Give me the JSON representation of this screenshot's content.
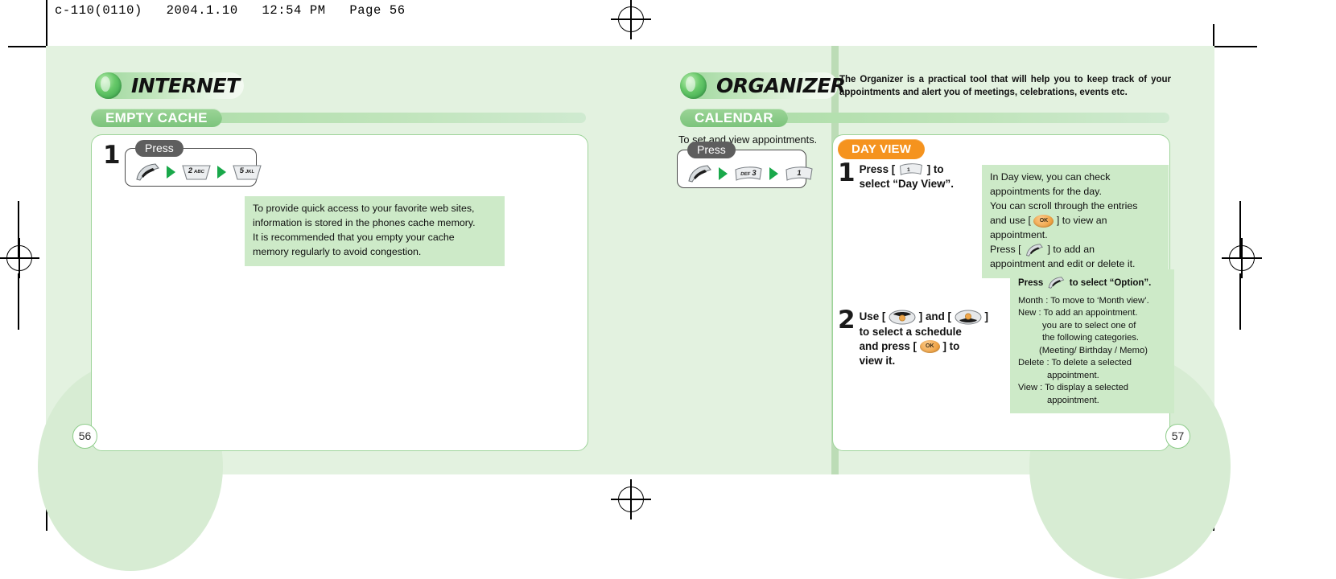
{
  "print_header": "c-110(0110)   2004.1.10   12:54 PM   Page 56",
  "left_page": {
    "section_title": "INTERNET",
    "sub_title": "EMPTY CACHE",
    "page_number": "56",
    "press_label": "Press",
    "keys": [
      {
        "icon": "pen-icon",
        "label": ""
      },
      {
        "icon": "key-icon",
        "label": "2",
        "sub": "ABC"
      },
      {
        "icon": "key-icon",
        "label": "5",
        "sub": "JKL"
      }
    ],
    "step1_number": "1",
    "note_lines": [
      "To provide quick access to your favorite web sites,",
      "information is stored in the phones cache memory.",
      "It is recommended that you empty your cache",
      "memory regularly to avoid congestion."
    ]
  },
  "right_page": {
    "section_title": "ORGANIZER",
    "intro": "The Organizer is a practical tool that will help you to keep track of your appointments and alert you of meetings, celebrations, events etc.",
    "sub_title": "CALENDAR",
    "lead_line": "To set and view appointments.",
    "page_number": "57",
    "press_label": "Press",
    "keys": [
      {
        "icon": "pen-icon",
        "label": ""
      },
      {
        "icon": "key-icon",
        "label": "3",
        "sub": "DEF"
      },
      {
        "icon": "key-icon",
        "label": "1",
        "sub": ""
      }
    ],
    "day_view_badge": "DAY VIEW",
    "step1": {
      "number": "1",
      "before_key": "Press [",
      "after_key": "] to",
      "line2": "select “Day View”."
    },
    "step2": {
      "number": "2",
      "part1": "Use [",
      "part2": "] and [",
      "part3": "]",
      "line2": "to select a schedule",
      "line3_a": "and press [",
      "line3_b": "] to",
      "line4": "view it."
    },
    "info_box": {
      "line1": "In Day view, you can check",
      "line2": "appointments for the day.",
      "line3": "You can scroll through the entries",
      "line4_a": "and use [",
      "line4_b": "] to view an",
      "line5": "appointment.",
      "line6_a": "Press [",
      "line6_b": "] to add an",
      "line7": "appointment and edit or delete it."
    },
    "option_box": {
      "heading_a": "Press",
      "heading_b": "to select “Option”.",
      "items": [
        "Month : To move to ‘Month view’.",
        "New : To add an appointment.",
        "you are to select one of",
        "the following categories.",
        "(Meeting/ Birthday / Memo)",
        "Delete : To delete a selected",
        "appointment.",
        "View : To display a selected",
        "appointment."
      ]
    }
  },
  "colors": {
    "page_bg": "#e3f2e0",
    "note_bg": "#cdeac8",
    "accent_green": "#2f9e46",
    "badge_orange": "#f5931e",
    "panel_border": "#9ed49a"
  }
}
